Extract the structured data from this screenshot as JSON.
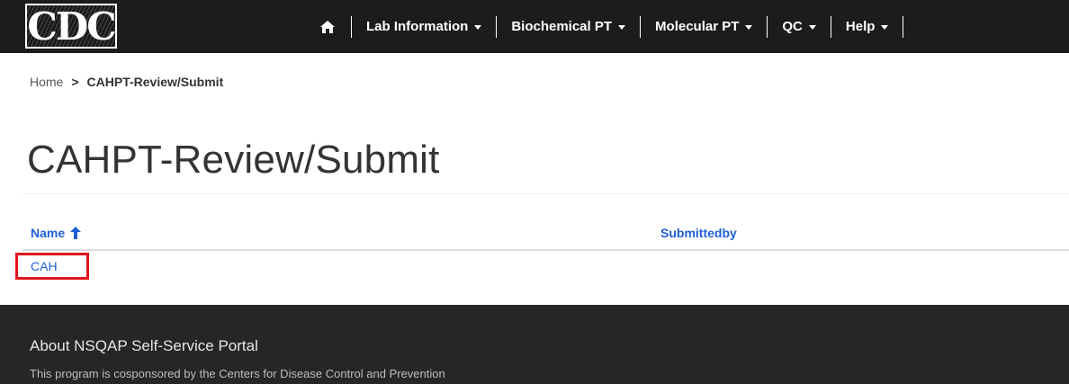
{
  "header": {
    "logo_text": "CDC",
    "nav_items": [
      {
        "label": "Lab Information"
      },
      {
        "label": "Biochemical PT"
      },
      {
        "label": "Molecular PT"
      },
      {
        "label": "QC"
      },
      {
        "label": "Help"
      }
    ],
    "icons": {
      "home": "home-icon",
      "dropdown": "caret-down-icon"
    }
  },
  "breadcrumb": {
    "home": "Home",
    "separator": ">",
    "current": "CAHPT-Review/Submit"
  },
  "page": {
    "title": "CAHPT-Review/Submit"
  },
  "table": {
    "columns": [
      {
        "label": "Name",
        "sort": "ascending",
        "sort_icon": "arrow-up-icon"
      },
      {
        "label": "Submittedby"
      }
    ],
    "rows": [
      {
        "name": "CAH",
        "submittedby": "",
        "highlighted": true
      }
    ]
  },
  "footer": {
    "title": "About NSQAP Self-Service Portal",
    "text": "This program is cosponsored by the Centers for Disease Control and Prevention"
  },
  "colors": {
    "nav_background": "#1c1c1c",
    "link": "#1f5fd6",
    "highlight_border": "#e0141b",
    "footer_background": "#262626"
  }
}
